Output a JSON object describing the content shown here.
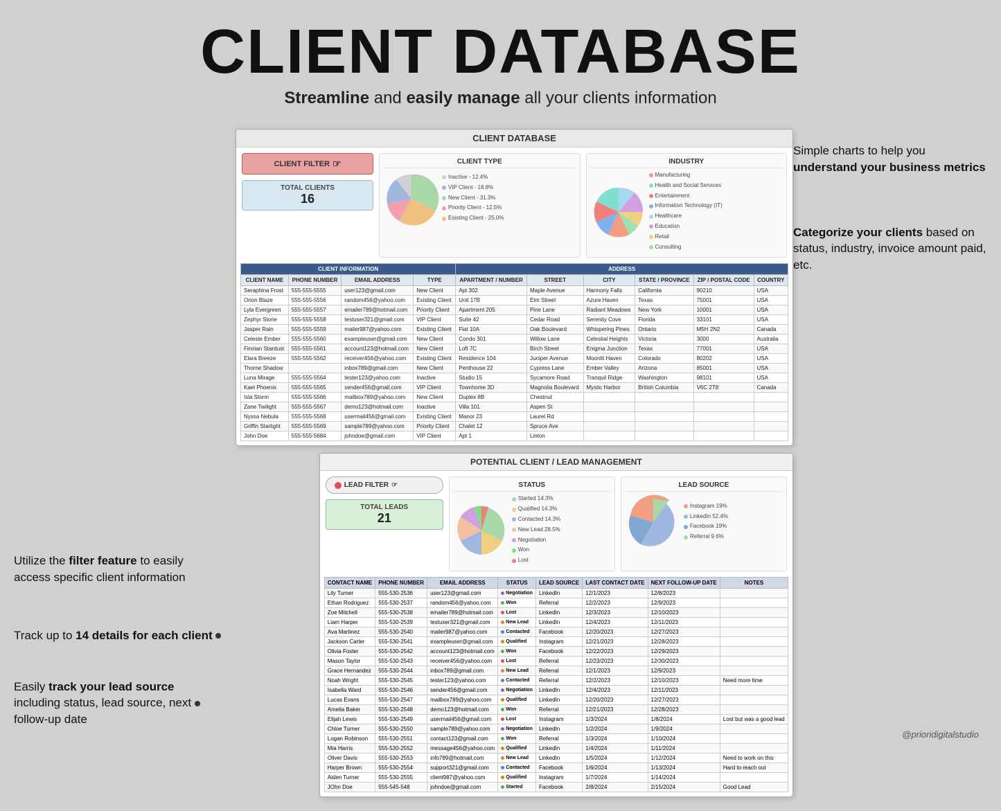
{
  "header": {
    "main_title": "CLIENT DATABASE",
    "subtitle_part1": "Streamline",
    "subtitle_middle": " and ",
    "subtitle_part2": "easily manage",
    "subtitle_end": " all your clients information"
  },
  "top_spreadsheet": {
    "title": "CLIENT DATABASE",
    "filter_btn_label": "CLIENT FILTER",
    "total_clients_label": "TOTAL CLIENTS",
    "total_clients_value": "16",
    "client_type_chart": {
      "title": "CLIENT TYPE",
      "segments": [
        {
          "label": "New Client",
          "value": 31.3,
          "color": "#a8d8a8"
        },
        {
          "label": "Existing Client",
          "value": 25.0,
          "color": "#f0c080"
        },
        {
          "label": "Priority Client",
          "value": 12.5,
          "color": "#f0a0b0"
        },
        {
          "label": "VIP Client",
          "value": 18.8,
          "color": "#a0b8e0"
        },
        {
          "label": "Inactive",
          "value": 12.4,
          "color": "#d0d0d0"
        }
      ]
    },
    "industry_chart": {
      "title": "INDUSTRY",
      "segments": [
        {
          "label": "Healthcare",
          "value": 12.5,
          "color": "#a8d8f0"
        },
        {
          "label": "Education",
          "value": 12.5,
          "color": "#d0a0e0"
        },
        {
          "label": "Retail",
          "value": 6.3,
          "color": "#f0d080"
        },
        {
          "label": "Consulting",
          "value": 6.3,
          "color": "#a0e0b0"
        },
        {
          "label": "Manufacturing",
          "value": 18.8,
          "color": "#f0a080"
        },
        {
          "label": "IT",
          "value": 12.5,
          "color": "#80b0f0"
        },
        {
          "label": "Entertainment",
          "value": 12.5,
          "color": "#f08080"
        },
        {
          "label": "Social Services",
          "value": 18.6,
          "color": "#80e0d0"
        }
      ]
    },
    "table_headers": {
      "client_info": "CLIENT INFORMATION",
      "address": "ADDRESS",
      "cols": [
        "CLIENT NAME",
        "PHONE NUMBER",
        "EMAIL ADDRESS",
        "TYPE",
        "APARTMENT / NUMBER",
        "STREET",
        "CITY",
        "STATE / PROVINCE",
        "ZIP / POSTAL CODE",
        "COUNTRY"
      ]
    },
    "rows": [
      [
        "Seraphina Frost",
        "555-555-5555",
        "user123@gmail.com",
        "New Client",
        "Apt 302",
        "Maple Avenue",
        "Harmony Falls",
        "California",
        "90210",
        "USA"
      ],
      [
        "Orion Blaze",
        "555-555-5556",
        "random456@yahoo.com",
        "Existing Client",
        "Unit 17B",
        "Elm Street",
        "Azure Haven",
        "Texas",
        "75001",
        "USA"
      ],
      [
        "Lyla Evergreen",
        "555-555-5557",
        "emailer789@hotmail.com",
        "Priority Client",
        "Apartment 205",
        "Pine Lane",
        "Radiant Meadows",
        "New York",
        "10001",
        "USA"
      ],
      [
        "Zephyr Stone",
        "555-555-5558",
        "testuser321@gmail.com",
        "VIP Client",
        "Suite 42",
        "Cedar Road",
        "Serenity Cove",
        "Florida",
        "33101",
        "USA"
      ],
      [
        "Jasper Rain",
        "555-555-5559",
        "mailer987@yahoo.com",
        "Existing Client",
        "Flat 10A",
        "Oak Boulevard",
        "Whispering Pines",
        "Ontario",
        "M5H 2N2",
        "Canada"
      ],
      [
        "Celeste Ember",
        "555-555-5560",
        "exampleuser@gmail.com",
        "New Client",
        "Condo 301",
        "Willow Lane",
        "Celestial Heights",
        "Victoria",
        "3000",
        "Australia"
      ],
      [
        "Finnian Stardust",
        "555-555-5561",
        "account123@hotmail.com",
        "New Client",
        "Loft 7C",
        "Birch Street",
        "Enigma Junction",
        "Texas",
        "77001",
        "USA"
      ],
      [
        "Elara Breeze",
        "555-555-5562",
        "receiver456@yahoo.com",
        "Existing Client",
        "Residence 104",
        "Juniper Avenue",
        "Moonlit Haven",
        "Colorado",
        "80202",
        "USA"
      ],
      [
        "Thorne Shadow",
        "",
        "inbox789@gmail.com",
        "New Client",
        "Penthouse 22",
        "Cypress Lane",
        "Ember Valley",
        "Arizona",
        "85001",
        "USA"
      ],
      [
        "Luna Mirage",
        "555-555-5564",
        "tester123@yahoo.com",
        "Inactive",
        "Studio 15",
        "Sycamore Road",
        "Tranquil Ridge",
        "Washington",
        "98101",
        "USA"
      ],
      [
        "Kael Phoenix",
        "555-555-5565",
        "sender456@gmail.com",
        "VIP Client",
        "Townhome 3D",
        "Magnolia Boulevard",
        "Mystic Harbor",
        "British Columbia",
        "V6C 2T8",
        "Canada"
      ],
      [
        "Isla Storm",
        "555-555-5566",
        "mailbox789@yahoo.com",
        "New Client",
        "Duplex 8B",
        "Chestnut",
        "",
        "",
        "",
        ""
      ],
      [
        "Zane Twilight",
        "555-555-5567",
        "demo123@hotmail.com",
        "Inactive",
        "Villa 101",
        "Aspen St",
        "",
        "",
        "",
        ""
      ],
      [
        "Nyssa Nebula",
        "555-555-5568",
        "usermail456@gmail.com",
        "Existing Client",
        "Manor 23",
        "Laurel Rd",
        "",
        "",
        "",
        ""
      ],
      [
        "Griffin Starlight",
        "555-555-5569",
        "sample789@yahoo.com",
        "Priority Client",
        "Chalet 12",
        "Spruce Ave",
        "",
        "",
        "",
        ""
      ],
      [
        "John Doe",
        "555-555-5684",
        "johndoe@gmail.com",
        "VIP Client",
        "Apt 1",
        "Linton",
        "",
        "",
        "",
        ""
      ]
    ]
  },
  "bottom_spreadsheet": {
    "title": "POTENTIAL CLIENT / LEAD MANAGEMENT",
    "filter_btn_label": "LEAD FILTER",
    "total_leads_label": "TOTAL LEADS",
    "total_leads_value": "21",
    "status_chart": {
      "title": "STATUS",
      "segments": [
        {
          "label": "Started",
          "value": 14.3,
          "color": "#a8d8a8"
        },
        {
          "label": "Qualified",
          "value": 14.3,
          "color": "#f0d080"
        },
        {
          "label": "Contacted",
          "value": 14.3,
          "color": "#a0b8e0"
        },
        {
          "label": "New Lead",
          "value": 28.5,
          "color": "#f0c0a0"
        },
        {
          "label": "Negotiation",
          "value": 14.3,
          "color": "#d0a0e0"
        },
        {
          "label": "Won",
          "value": 9.5,
          "color": "#80e080"
        },
        {
          "label": "Lost",
          "value": 4.8,
          "color": "#f08080"
        }
      ]
    },
    "lead_source_chart": {
      "title": "LEAD SOURCE",
      "segments": [
        {
          "label": "Instagram",
          "value": 19.0,
          "color": "#f0a080"
        },
        {
          "label": "LinkedIn",
          "value": 52.4,
          "color": "#a0b8e0"
        },
        {
          "label": "Facebook",
          "value": 19.0,
          "color": "#80a8d0"
        },
        {
          "label": "Referral",
          "value": 9.6,
          "color": "#a8d8a8"
        }
      ]
    },
    "table_headers": [
      "CONTACT NAME",
      "PHONE NUMBER",
      "EMAIL ADDRESS",
      "STATUS",
      "LEAD SOURCE",
      "LAST CONTACT DATE",
      "NEXT FOLLOW-UP DATE",
      "NOTES"
    ],
    "rows": [
      [
        "Lily Turner",
        "555-530-2536",
        "user123@gmail.com",
        "Negotiation",
        "LinkedIn",
        "12/1/2023",
        "12/8/2023",
        ""
      ],
      [
        "Ethan Rodriguez",
        "555-530-2537",
        "random456@yahoo.com",
        "Won",
        "Referral",
        "12/2/2023",
        "12/9/2023",
        ""
      ],
      [
        "Zoe Mitchell",
        "555-530-2538",
        "emailer789@hotmail.com",
        "Lost",
        "LinkedIn",
        "12/3/2023",
        "12/10/2023",
        ""
      ],
      [
        "Liam Harper",
        "555-530-2539",
        "testuser321@gmail.com",
        "New Lead",
        "LinkedIn",
        "12/4/2023",
        "12/11/2023",
        ""
      ],
      [
        "Ava Martinez",
        "555-530-2540",
        "mailer987@yahoo.com",
        "Contacted",
        "Facebook",
        "12/20/2023",
        "12/27/2023",
        ""
      ],
      [
        "Jackson Carter",
        "555-530-2541",
        "exampleuser@gmail.com",
        "Qualified",
        "Instagram",
        "12/21/2023",
        "12/28/2023",
        ""
      ],
      [
        "Olivia Foster",
        "555-530-2542",
        "account123@hotmail.com",
        "Won",
        "Facebook",
        "12/22/2023",
        "12/29/2023",
        ""
      ],
      [
        "Mason Taylor",
        "555-530-2543",
        "receiver456@yahoo.com",
        "Lost",
        "Referral",
        "12/23/2023",
        "12/30/2023",
        ""
      ],
      [
        "Grace Hernandez",
        "555-530-2544",
        "inbox789@gmail.com",
        "New Lead",
        "Referral",
        "12/1/2023",
        "12/9/2023",
        ""
      ],
      [
        "Noah Wright",
        "555-530-2545",
        "tester123@yahoo.com",
        "Contacted",
        "Referral",
        "12/2/2023",
        "12/10/2023",
        "Need more time"
      ],
      [
        "Isabella Ward",
        "555-530-2546",
        "sender456@gmail.com",
        "Negotiation",
        "LinkedIn",
        "12/4/2023",
        "12/11/2023",
        ""
      ],
      [
        "Lucas Evans",
        "555-530-2547",
        "mailbox789@yahoo.com",
        "Qualified",
        "LinkedIn",
        "12/20/2023",
        "12/27/2023",
        ""
      ],
      [
        "Amelia Baker",
        "555-530-2548",
        "demo123@hotmail.com",
        "Won",
        "Referral",
        "12/21/2023",
        "12/28/2023",
        ""
      ],
      [
        "Elijah Lewis",
        "555-530-2549",
        "usermail456@gmail.com",
        "Lost",
        "Instagram",
        "1/3/2024",
        "1/8/2024",
        "Lost but was a good lead"
      ],
      [
        "Chloe Turner",
        "555-530-2550",
        "sample789@yahoo.com",
        "Negotiation",
        "LinkedIn",
        "1/2/2024",
        "1/9/2024",
        ""
      ],
      [
        "Logan Robinson",
        "555-530-2551",
        "contact123@gmail.com",
        "Won",
        "Referral",
        "1/3/2024",
        "1/10/2024",
        ""
      ],
      [
        "Mia Harris",
        "555-530-2552",
        "message456@yahoo.com",
        "Qualified",
        "LinkedIn",
        "1/4/2024",
        "1/11/2024",
        ""
      ],
      [
        "Oliver Davis",
        "555-530-2553",
        "info789@hotmail.com",
        "New Lead",
        "LinkedIn",
        "1/5/2024",
        "1/12/2024",
        "Need to work on this"
      ],
      [
        "Harper Brown",
        "555-530-2554",
        "support321@gmail.com",
        "Contacted",
        "Facebook",
        "1/6/2024",
        "1/13/2024",
        "Hard to reach out"
      ],
      [
        "Aiden Turner",
        "555-530-2555",
        "client987@yahoo.com",
        "Qualified",
        "Instagram",
        "1/7/2024",
        "1/14/2024",
        ""
      ],
      [
        "JOhn Doe",
        "555-545-548",
        "johndoe@gmail.com",
        "Started",
        "Facebook",
        "2/8/2024",
        "2/15/2024",
        "Good Lead"
      ]
    ]
  },
  "right_annotations": [
    {
      "text": "Simple charts to help you understand your business metrics",
      "bold_part": "understand your business metrics"
    },
    {
      "text": "Categorize your clients based on status, industry, invoice amount paid, etc.",
      "bold_part": "Categorize your clients"
    }
  ],
  "left_annotations": [
    {
      "text": "Utilize the filter feature to easily access specific client information",
      "bold_part": "filter feature"
    },
    {
      "text": "Track up to 14 details for each client",
      "bold_part": "14 details for each client"
    },
    {
      "text": "Easily track your lead source including status, lead source, next follow-up date",
      "bold_part": "track your lead source"
    }
  ],
  "watermark": "@prioridigitalstudio",
  "status_colors": {
    "Won": "#50b050",
    "Lost": "#e05050",
    "Negotiation": "#9060c0",
    "Qualified": "#c09000",
    "Contacted": "#5080d0",
    "New Lead": "#e08030",
    "Started": "#60a060"
  }
}
